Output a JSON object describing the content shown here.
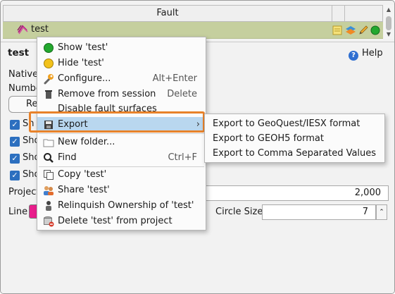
{
  "table": {
    "header": "Fault",
    "row_name": "test"
  },
  "panel": {
    "title": "test",
    "help": "Help",
    "native_label": "Native",
    "number_label": "Numbe",
    "rec_button": "Re",
    "show_labels": [
      "Sh",
      "Sho",
      "Sho",
      "Sho"
    ],
    "projected_label": "Project",
    "projected_value": "2,000",
    "line_label": "Line",
    "circle_size_label": "Circle Size",
    "circle_size_value": "7"
  },
  "context_menu": {
    "items": [
      {
        "label": "Show 'test'",
        "shortcut": "",
        "icon": "green-dot-icon"
      },
      {
        "label": "Hide 'test'",
        "shortcut": "",
        "icon": "yellow-dot-icon"
      },
      {
        "label": "Configure...",
        "shortcut": "Alt+Enter",
        "icon": "wrench-icon"
      },
      {
        "label": "Remove from session",
        "shortcut": "Delete",
        "icon": "trash-icon"
      },
      {
        "label": "Disable fault surfaces",
        "shortcut": "",
        "icon": ""
      },
      {
        "label": "Export",
        "shortcut": "",
        "icon": "save-icon"
      },
      {
        "label": "New folder...",
        "shortcut": "",
        "icon": "folder-icon"
      },
      {
        "label": "Find",
        "shortcut": "Ctrl+F",
        "icon": "search-icon"
      },
      {
        "label": "Copy 'test'",
        "shortcut": "",
        "icon": "copy-icon"
      },
      {
        "label": "Share 'test'",
        "shortcut": "",
        "icon": "share-icon"
      },
      {
        "label": "Relinquish Ownership of 'test'",
        "shortcut": "",
        "icon": "person-icon"
      },
      {
        "label": "Delete 'test' from project",
        "shortcut": "",
        "icon": "database-delete-icon"
      }
    ]
  },
  "export_submenu": {
    "items": [
      "Export to GeoQuest/IESX format",
      "Export to GEOH5 format",
      "Export to Comma Separated Values"
    ]
  },
  "colors": {
    "row_highlight": "#c5cf9e",
    "menu_hover": "#b9d7ef",
    "callout": "#e8822a",
    "line_color": "#e91e8c"
  }
}
